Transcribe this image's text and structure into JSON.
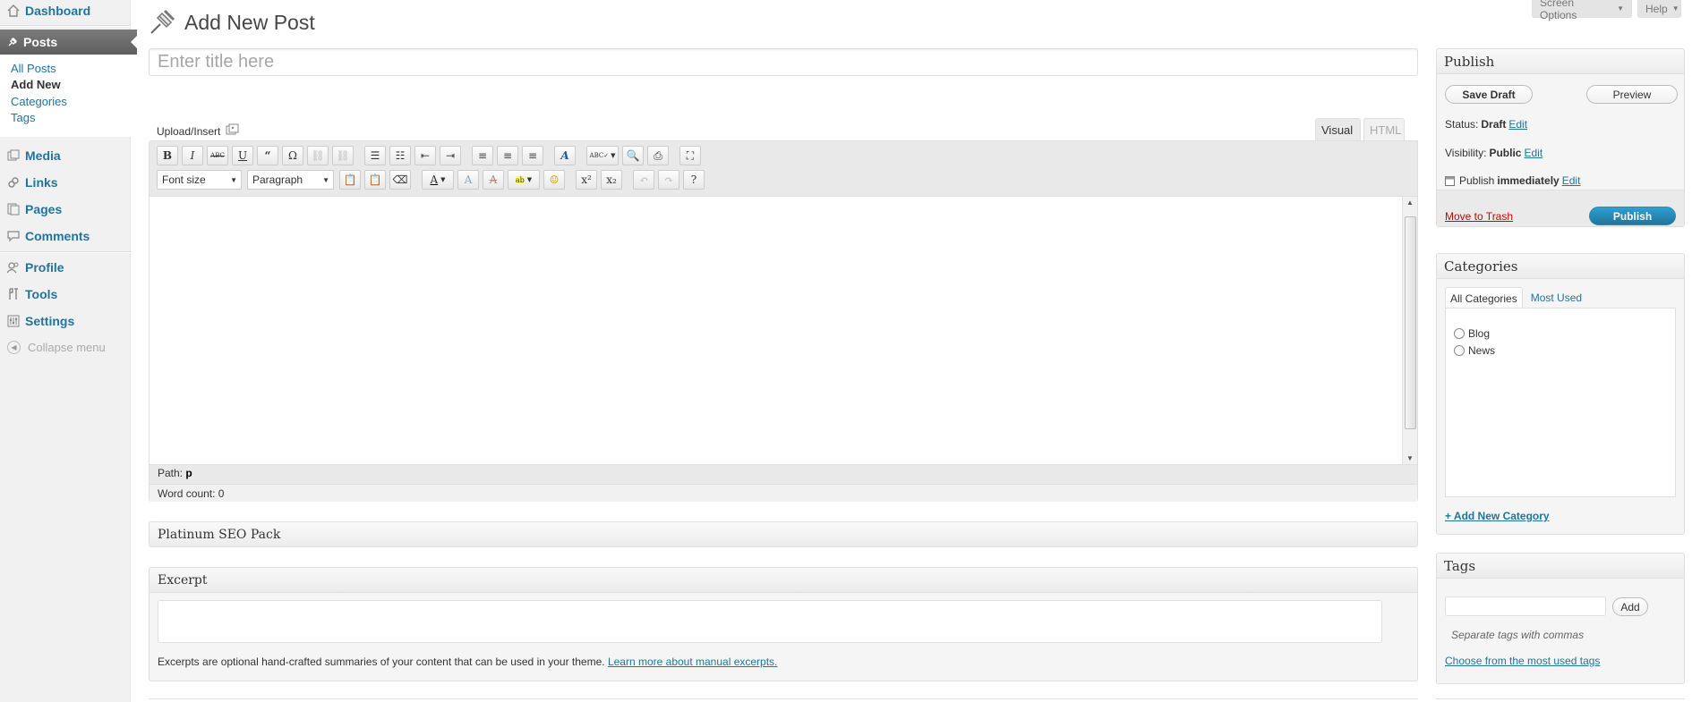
{
  "menu": {
    "dashboard": "Dashboard",
    "posts": "Posts",
    "posts_sub": [
      "All Posts",
      "Add New",
      "Categories",
      "Tags"
    ],
    "media": "Media",
    "links": "Links",
    "pages": "Pages",
    "comments": "Comments",
    "profile": "Profile",
    "tools": "Tools",
    "settings": "Settings",
    "collapse": "Collapse menu"
  },
  "header": {
    "title": "Add New Post",
    "screen_options": "Screen Options",
    "help": "Help"
  },
  "post": {
    "title_placeholder": "Enter title here",
    "upload_insert": "Upload/Insert",
    "tab_visual": "Visual",
    "tab_html": "HTML",
    "font_size": "Font size",
    "format": "Paragraph",
    "path_label": "Path:",
    "path_value": "p",
    "word_count": "Word count: 0"
  },
  "seo_box": {
    "title": "Platinum SEO Pack"
  },
  "excerpt_box": {
    "title": "Excerpt",
    "help": "Excerpts are optional hand-crafted summaries of your content that can be used in your theme.",
    "help_link": "Learn more about manual excerpts."
  },
  "publish_box": {
    "title": "Publish",
    "save_draft": "Save Draft",
    "preview": "Preview",
    "status_label": "Status:",
    "status_value": "Draft",
    "visibility_label": "Visibility:",
    "visibility_value": "Public",
    "publish_label": "Publish",
    "publish_value": "immediately",
    "edit": "Edit",
    "move_to_trash": "Move to Trash",
    "publish_button": "Publish",
    "accent": "#21759b"
  },
  "categories_box": {
    "title": "Categories",
    "tab_all": "All Categories",
    "tab_most_used": "Most Used",
    "items": [
      "Blog",
      "News"
    ],
    "add_new": "+ Add New Category"
  },
  "tags_box": {
    "title": "Tags",
    "add_button": "Add",
    "hint": "Separate tags with commas",
    "choose_link": "Choose from the most used tags"
  }
}
